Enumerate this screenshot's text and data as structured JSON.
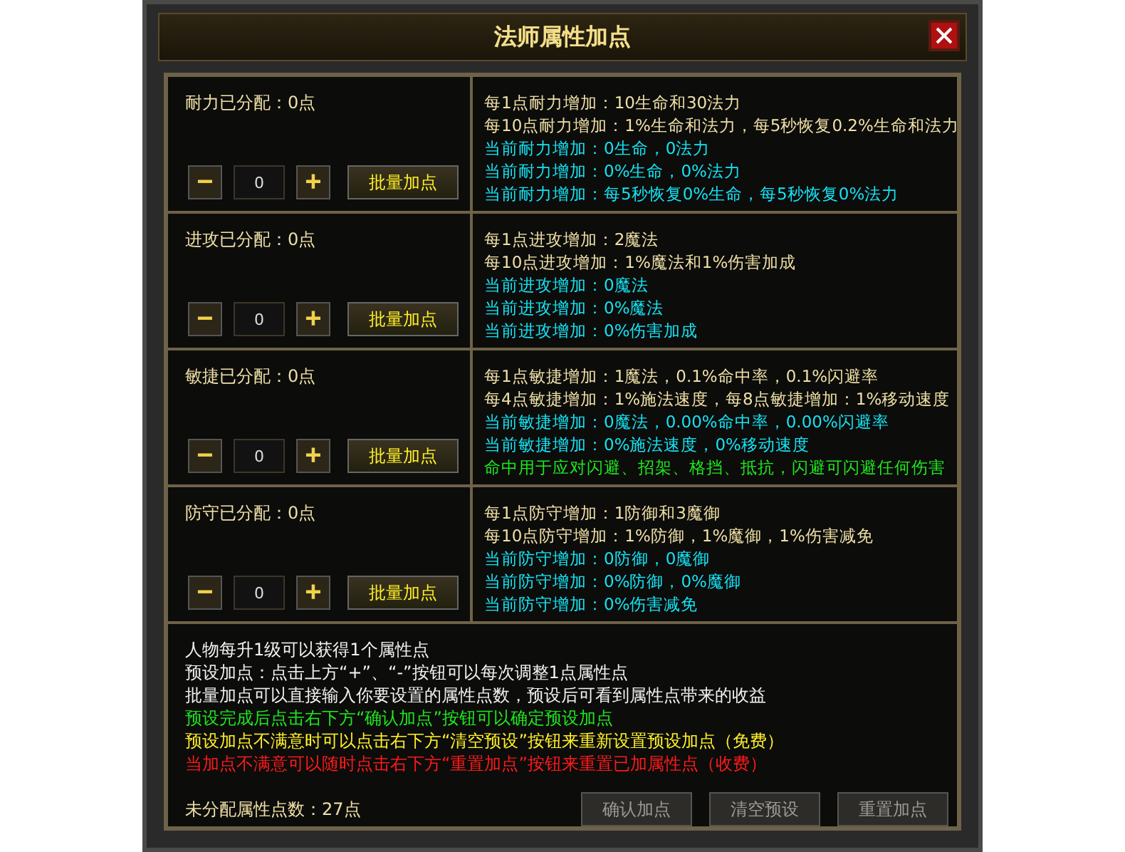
{
  "window": {
    "title": "法师属性加点"
  },
  "stats": [
    {
      "label": "耐力已分配：0点",
      "minus": "−",
      "value": "0",
      "plus": "+",
      "batch": "批量加点",
      "lines": [
        {
          "kind": "base",
          "text": "每1点耐力增加：10生命和30法力"
        },
        {
          "kind": "base",
          "text": "每10点耐力增加：1%生命和法力，每5秒恢复0.2%生命和法力"
        },
        {
          "kind": "current",
          "text": "当前耐力增加：0生命，0法力"
        },
        {
          "kind": "current",
          "text": "当前耐力增加：0%生命，0%法力"
        },
        {
          "kind": "current",
          "text": "当前耐力增加：每5秒恢复0%生命，每5秒恢复0%法力"
        }
      ]
    },
    {
      "label": "进攻已分配：0点",
      "minus": "−",
      "value": "0",
      "plus": "+",
      "batch": "批量加点",
      "lines": [
        {
          "kind": "base",
          "text": "每1点进攻增加：2魔法"
        },
        {
          "kind": "base",
          "text": "每10点进攻增加：1%魔法和1%伤害加成"
        },
        {
          "kind": "current",
          "text": "当前进攻增加：0魔法"
        },
        {
          "kind": "current",
          "text": "当前进攻增加：0%魔法"
        },
        {
          "kind": "current",
          "text": "当前进攻增加：0%伤害加成"
        }
      ]
    },
    {
      "label": "敏捷已分配：0点",
      "minus": "−",
      "value": "0",
      "plus": "+",
      "batch": "批量加点",
      "lines": [
        {
          "kind": "base",
          "text": "每1点敏捷增加：1魔法，0.1%命中率，0.1%闪避率"
        },
        {
          "kind": "base",
          "text": "每4点敏捷增加：1%施法速度，每8点敏捷增加：1%移动速度"
        },
        {
          "kind": "current",
          "text": "当前敏捷增加：0魔法，0.00%命中率，0.00%闪避率"
        },
        {
          "kind": "current",
          "text": "当前敏捷增加：0%施法速度，0%移动速度"
        },
        {
          "kind": "note",
          "text": "命中用于应对闪避、招架、格挡、抵抗，闪避可闪避任何伤害"
        }
      ]
    },
    {
      "label": "防守已分配：0点",
      "minus": "−",
      "value": "0",
      "plus": "+",
      "batch": "批量加点",
      "lines": [
        {
          "kind": "base",
          "text": "每1点防守增加：1防御和3魔御"
        },
        {
          "kind": "base",
          "text": "每10点防守增加：1%防御，1%魔御，1%伤害减免"
        },
        {
          "kind": "current",
          "text": "当前防守增加：0防御，0魔御"
        },
        {
          "kind": "current",
          "text": "当前防守增加：0%防御，0%魔御"
        },
        {
          "kind": "current",
          "text": "当前防守增加：0%伤害减免"
        }
      ]
    }
  ],
  "help": [
    {
      "kind": "plain",
      "text": "人物每升1级可以获得1个属性点"
    },
    {
      "kind": "plain",
      "text": "预设加点：点击上方“+”、“-”按钮可以每次调整1点属性点"
    },
    {
      "kind": "plain",
      "text": "批量加点可以直接输入你要设置的属性点数，预设后可看到属性点带来的收益"
    },
    {
      "kind": "confirm",
      "text": "预设完成后点击右下方“确认加点”按钮可以确定预设加点"
    },
    {
      "kind": "clear",
      "text": "预设加点不满意时可以点击右下方“清空预设”按钮来重新设置预设加点（免费）"
    },
    {
      "kind": "reset",
      "text": "当加点不满意可以随时点击右下方“重置加点”按钮来重置已加属性点（收费）"
    }
  ],
  "unassigned": "未分配属性点数：27点",
  "buttons": [
    {
      "label": "确认加点",
      "disabled": true
    },
    {
      "label": "清空预设",
      "disabled": true
    },
    {
      "label": "重置加点",
      "disabled": true
    }
  ]
}
